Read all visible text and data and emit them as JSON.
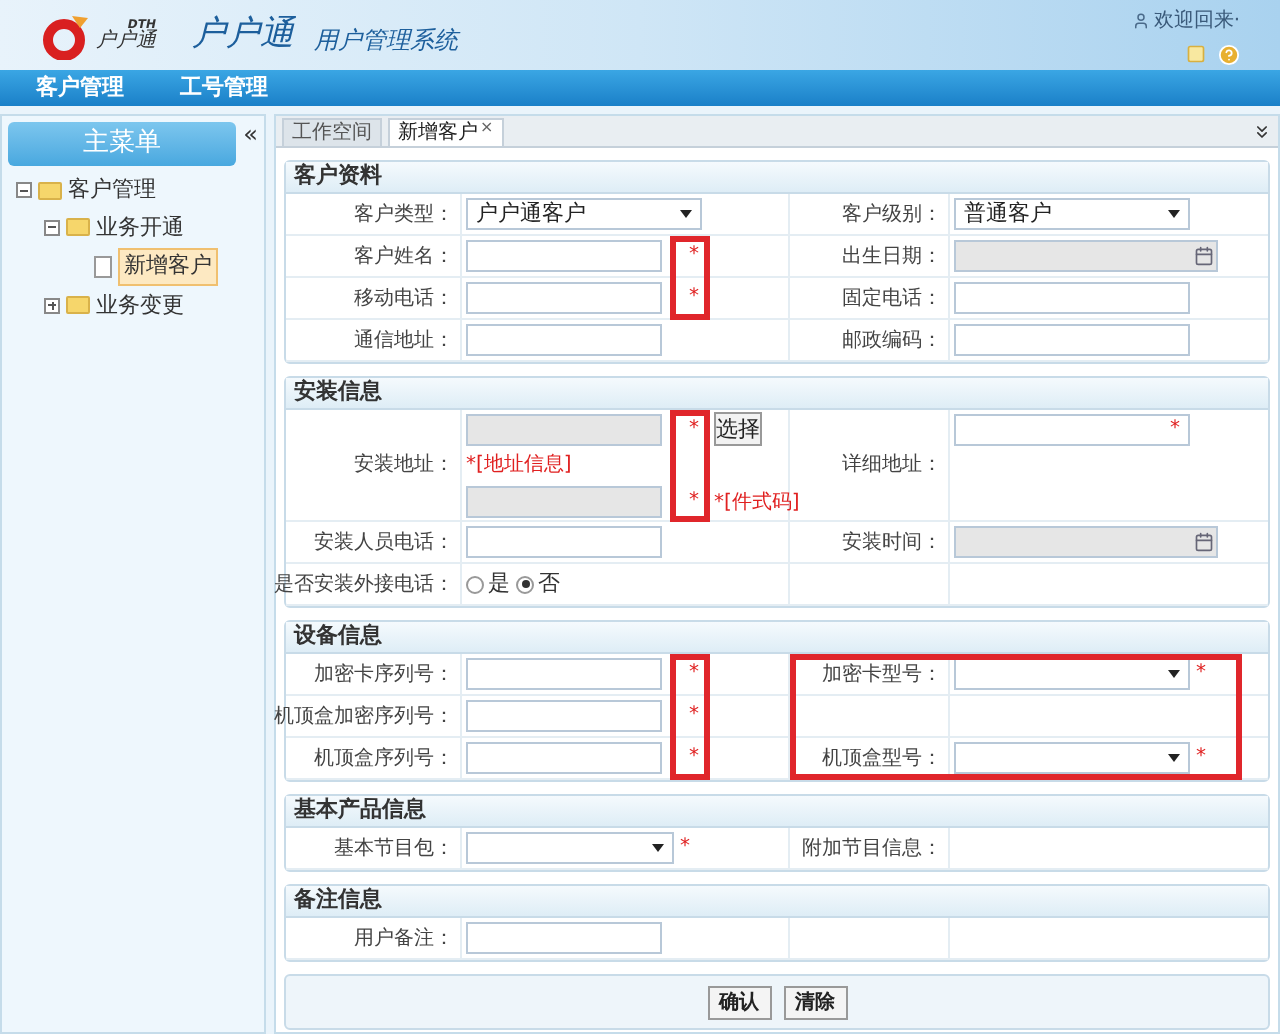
{
  "header": {
    "logo_text": "DTH",
    "brand": "户户通",
    "title": "户户通",
    "subtitle": "用户管理系统",
    "welcome": "欢迎回来·"
  },
  "nav": [
    "客户管理",
    "工号管理"
  ],
  "sidebar": {
    "title": "主菜单",
    "collapse": "«",
    "tree": [
      {
        "kind": "folder",
        "label": "客户管理",
        "expanded": true,
        "children": [
          {
            "kind": "folder",
            "label": "业务开通",
            "expanded": true,
            "children": [
              {
                "kind": "file",
                "label": "新增客户",
                "selected": true
              }
            ]
          },
          {
            "kind": "folder",
            "label": "业务变更",
            "expanded": false
          }
        ]
      }
    ]
  },
  "tabs": [
    {
      "label": "工作空间",
      "selected": false
    },
    {
      "label": "新增客户",
      "selected": true,
      "close": "×"
    }
  ],
  "sections": [
    {
      "title": "客户资料",
      "rows": [
        {
          "left": {
            "label": "客户类型：",
            "kind": "select",
            "value": "户户通客户"
          },
          "right": {
            "label": "客户级别：",
            "kind": "select",
            "value": "普通客户"
          }
        },
        {
          "left": {
            "label": "客户姓名：",
            "kind": "text",
            "mark": "*",
            "framed": true
          },
          "right": {
            "label": "出生日期：",
            "kind": "date"
          }
        },
        {
          "left": {
            "label": "移动电话：",
            "kind": "text",
            "mark": "*",
            "framed": true
          },
          "right": {
            "label": "固定电话：",
            "kind": "text"
          }
        },
        {
          "left": {
            "label": "通信地址：",
            "kind": "text"
          },
          "right": {
            "label": "邮政编码：",
            "kind": "text"
          }
        }
      ]
    },
    {
      "title": "安装信息",
      "rows": [
        {
          "left": {
            "label": "安装地址：",
            "kind": "address",
            "mark": "*",
            "mark2": "*",
            "button": "选择",
            "note": "*[地址信息]",
            "note2": "*[件式码]",
            "framed": true
          },
          "right": {
            "label": "详细地址：",
            "kind": "text",
            "inner_mark": "*"
          }
        },
        {
          "left": {
            "label": "安装人员电话：",
            "kind": "text"
          },
          "right": {
            "label": "安装时间：",
            "kind": "date"
          }
        },
        {
          "left": {
            "label": "是否安装外接电话：",
            "kind": "radio",
            "options": [
              {
                "label": "是",
                "selected": false
              },
              {
                "label": "否",
                "selected": true
              }
            ]
          }
        }
      ]
    },
    {
      "title": "设备信息",
      "rows": [
        {
          "left": {
            "label": "加密卡序列号：",
            "kind": "text",
            "mark": "*",
            "framed": true
          },
          "right": {
            "label": "加密卡型号：",
            "kind": "select",
            "mark": "*",
            "framed": true
          }
        },
        {
          "left": {
            "label": "机顶盒加密序列号：",
            "kind": "text",
            "mark": "*",
            "framed": true
          },
          "right": {
            "kind": "none",
            "framed": true
          }
        },
        {
          "left": {
            "label": "机顶盒序列号：",
            "kind": "text",
            "mark": "*",
            "framed": true
          },
          "right": {
            "label": "机顶盒型号：",
            "kind": "select",
            "mark": "*",
            "framed": true
          }
        }
      ]
    },
    {
      "title": "基本产品信息",
      "rows": [
        {
          "left": {
            "label": "基本节目包：",
            "kind": "select",
            "mark": "*"
          },
          "right": {
            "label": "附加节目信息：",
            "kind": "none"
          }
        }
      ]
    },
    {
      "title": "备注信息",
      "rows": [
        {
          "left": {
            "label": "用户备注：",
            "kind": "text"
          }
        }
      ]
    }
  ],
  "buttons": [
    "确认",
    "清除"
  ]
}
